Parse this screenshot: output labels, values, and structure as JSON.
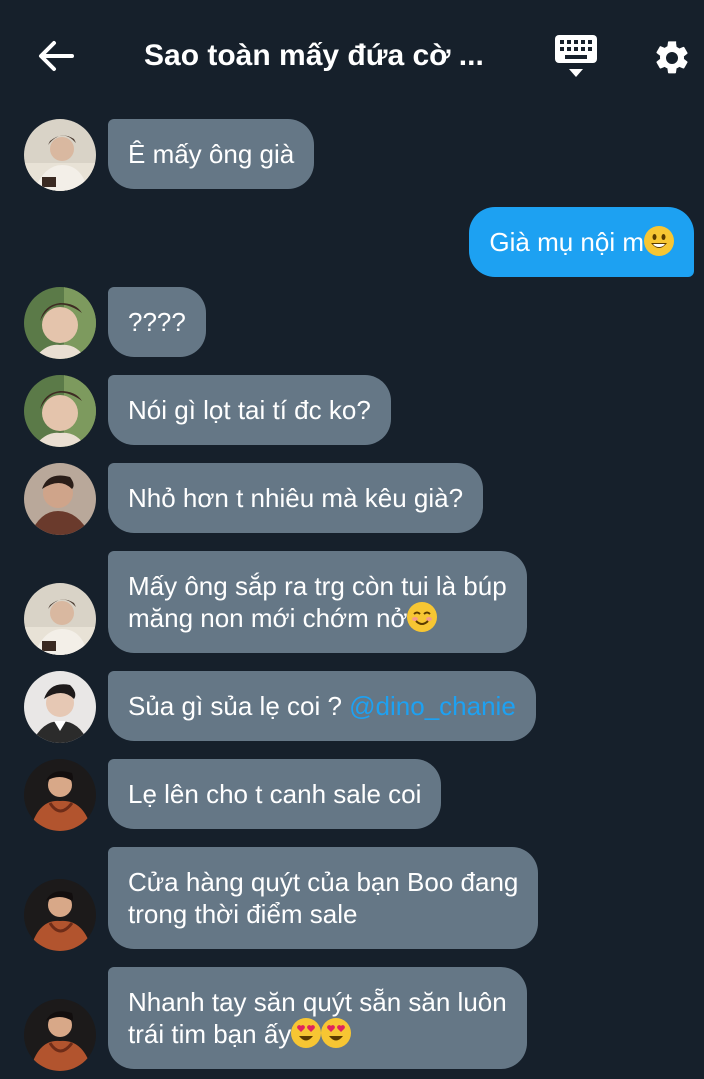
{
  "header": {
    "title": "Sao toàn mấy đứa cờ ..."
  },
  "messages": [
    {
      "text": "Ê mấy ông già",
      "side": "in"
    },
    {
      "text": "Già mụ nội m",
      "emoji": "grinning-face",
      "side": "out"
    },
    {
      "text": "????",
      "side": "in"
    },
    {
      "text": "Nói gì lọt tai tí đc ko?",
      "side": "in"
    },
    {
      "text": "Nhỏ hơn t nhiêu mà kêu già?",
      "side": "in"
    },
    {
      "line1": "Mấy ông sắp ra trg còn tui là búp",
      "line2": "măng non mới chớm nở",
      "emoji": "smiling-face",
      "side": "in"
    },
    {
      "text": "Sủa gì sủa lẹ coi ?",
      "mention": "@dino_chanie",
      "side": "in"
    },
    {
      "text": "Lẹ lên cho t canh sale coi",
      "side": "in"
    },
    {
      "line1": "Cửa hàng quýt của bạn Boo đang",
      "line2": "trong thời điểm sale",
      "side": "in"
    },
    {
      "line1": "Nhanh tay săn quýt sẵn săn luôn",
      "line2": "trái tim bạn ấy",
      "emoji": "heart-eyes-face",
      "side": "in"
    }
  ],
  "colors": {
    "background": "#16202b",
    "incoming_bubble": "#657786",
    "outgoing_bubble": "#1da1f2",
    "mention": "#1da1f2"
  }
}
